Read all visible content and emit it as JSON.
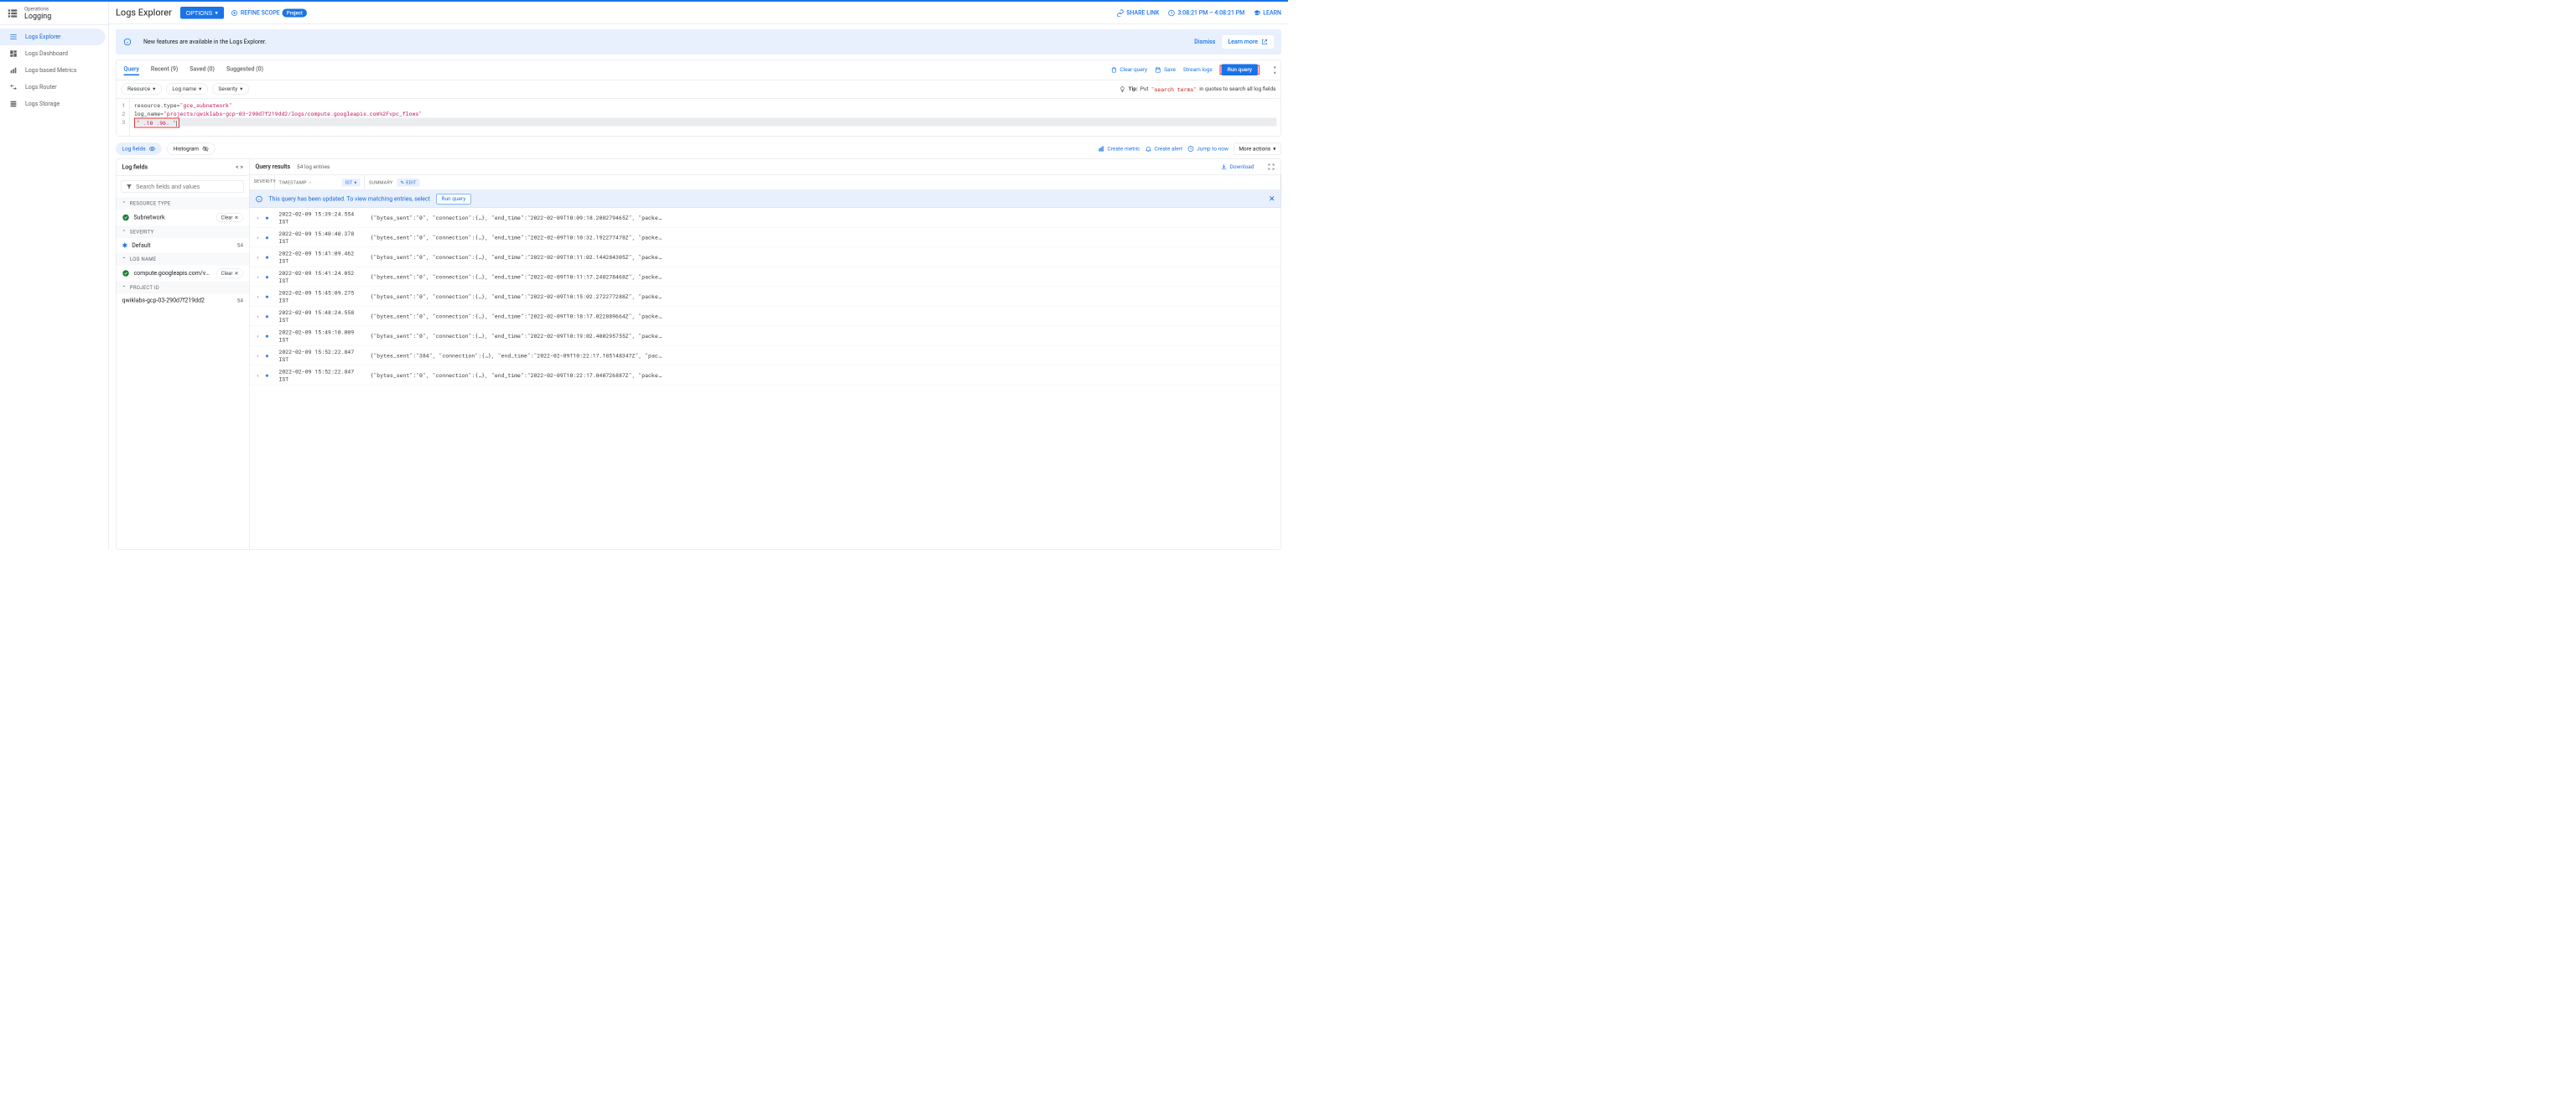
{
  "sidebar": {
    "subtitle": "Operations",
    "title": "Logging",
    "items": [
      {
        "label": "Logs Explorer"
      },
      {
        "label": "Logs Dashboard"
      },
      {
        "label": "Logs-based Metrics"
      },
      {
        "label": "Logs Router"
      },
      {
        "label": "Logs Storage"
      }
    ]
  },
  "header": {
    "page_title": "Logs Explorer",
    "options_button": "OPTIONS",
    "refine_scope": "REFINE SCOPE",
    "scope_chip": "Project",
    "share_link": "SHARE LINK",
    "time_range": "3:08:21 PM – 4:08:21 PM",
    "learn": "LEARN"
  },
  "banner": {
    "text": "New features are available in the Logs Explorer.",
    "dismiss": "Dismiss",
    "learn_more": "Learn more"
  },
  "query_panel": {
    "tabs": [
      {
        "label": "Query"
      },
      {
        "label": "Recent (9)"
      },
      {
        "label": "Saved (0)"
      },
      {
        "label": "Suggested (0)"
      }
    ],
    "clear_query": "Clear query",
    "save": "Save",
    "stream_logs": "Stream logs",
    "run_query": "Run query",
    "filters": {
      "resource": "Resource",
      "log_name": "Log name",
      "severity": "Severity"
    },
    "tip_label": "Tip:",
    "tip_prefix": "Put",
    "tip_code": "\"search terms\"",
    "tip_suffix": "in quotes to search all log fields",
    "code_lines": {
      "line1_id": "resource.type=",
      "line1_str": "\"gce_subnetwork\"",
      "line2_id": "log_name=",
      "line2_str": "\"projects/qwiklabs-gcp-03-290d7f219dd2/logs/compute.googleapis.com%2Fvpc_flows\"",
      "line3_box": "\"  .10 .96.  \""
    }
  },
  "results_toolbar": {
    "log_fields": "Log fields",
    "histogram": "Histogram",
    "create_metric": "Create metric",
    "create_alert": "Create alert",
    "jump_to_now": "Jump to now",
    "more_actions": "More actions"
  },
  "log_fields_panel": {
    "title": "Log fields",
    "search_placeholder": "Search fields and values",
    "groups": {
      "resource_type": "RESOURCE TYPE",
      "severity": "SEVERITY",
      "log_name": "LOG NAME",
      "project_id": "PROJECT ID"
    },
    "clear_label": "Clear",
    "items": {
      "subnetwork": "Subnetwork",
      "default": "Default",
      "default_count": "54",
      "vpc_flows": "compute.googleapis.com/vpc_fl…",
      "project": "qwiklabs-gcp-03-290d7f219dd2",
      "project_count": "54"
    }
  },
  "query_results": {
    "title": "Query results",
    "count": "54 log entries",
    "download": "Download",
    "columns": {
      "severity": "SEVERITY",
      "timestamp": "TIMESTAMP",
      "ist": "IST",
      "summary": "SUMMARY",
      "edit": "EDIT"
    },
    "notice": "This query has been updated. To view matching entries, select",
    "run_query": "Run query",
    "rows": [
      {
        "ts": "2022-02-09 15:39:24.554 IST",
        "summary": "{\"bytes_sent\":\"0\", \"connection\":{…}, \"end_time\":\"2022-02-09T10:09:18.208279465Z\", \"packe…"
      },
      {
        "ts": "2022-02-09 15:40:40.378 IST",
        "summary": "{\"bytes_sent\":\"0\", \"connection\":{…}, \"end_time\":\"2022-02-09T10:10:32.192277478Z\", \"packe…"
      },
      {
        "ts": "2022-02-09 15:41:09.462 IST",
        "summary": "{\"bytes_sent\":\"0\", \"connection\":{…}, \"end_time\":\"2022-02-09T10:11:02.144284305Z\", \"packe…"
      },
      {
        "ts": "2022-02-09 15:41:24.052 IST",
        "summary": "{\"bytes_sent\":\"0\", \"connection\":{…}, \"end_time\":\"2022-02-09T10:11:17.248278468Z\", \"packe…"
      },
      {
        "ts": "2022-02-09 15:45:09.275 IST",
        "summary": "{\"bytes_sent\":\"0\", \"connection\":{…}, \"end_time\":\"2022-02-09T10:15:02.272277288Z\", \"packe…"
      },
      {
        "ts": "2022-02-09 15:48:24.558 IST",
        "summary": "{\"bytes_sent\":\"0\", \"connection\":{…}, \"end_time\":\"2022-02-09T10:18:17.022889664Z\", \"packe…"
      },
      {
        "ts": "2022-02-09 15:49:10.009 IST",
        "summary": "{\"bytes_sent\":\"0\", \"connection\":{…}, \"end_time\":\"2022-02-09T10:19:02.400295755Z\", \"packe…"
      },
      {
        "ts": "2022-02-09 15:52:22.847 IST",
        "summary": "{\"bytes_sent\":\"384\", \"connection\":{…}, \"end_time\":\"2022-02-09T10:22:17.185148347Z\", \"pac…"
      },
      {
        "ts": "2022-02-09 15:52:22.847 IST",
        "summary": "{\"bytes_sent\":\"0\", \"connection\":{…}, \"end_time\":\"2022-02-09T10:22:17.040726887Z\", \"packe…"
      }
    ]
  }
}
